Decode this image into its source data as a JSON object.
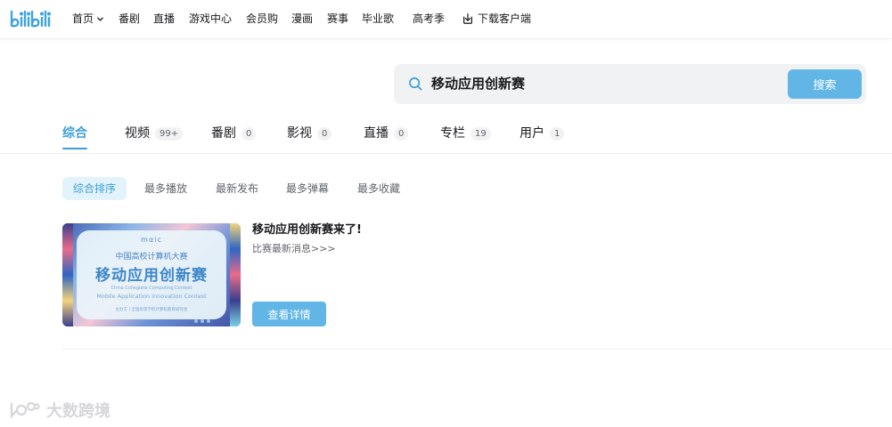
{
  "header": {
    "logo_text": "bilibili",
    "nav": [
      {
        "label": "首页"
      },
      {
        "label": "番剧"
      },
      {
        "label": "直播"
      },
      {
        "label": "游戏中心"
      },
      {
        "label": "会员购"
      },
      {
        "label": "漫画"
      },
      {
        "label": "赛事"
      },
      {
        "label": "毕业歌"
      },
      {
        "label": "高考季"
      },
      {
        "label": "下载客户端"
      }
    ]
  },
  "search": {
    "query": "移动应用创新赛",
    "button_label": "搜索"
  },
  "tabs": [
    {
      "label": "综合",
      "count": ""
    },
    {
      "label": "视频",
      "count": "99+"
    },
    {
      "label": "番剧",
      "count": "0"
    },
    {
      "label": "影视",
      "count": "0"
    },
    {
      "label": "直播",
      "count": "0"
    },
    {
      "label": "专栏",
      "count": "19"
    },
    {
      "label": "用户",
      "count": "1"
    }
  ],
  "sort_options": [
    {
      "label": "综合排序"
    },
    {
      "label": "最多播放"
    },
    {
      "label": "最新发布"
    },
    {
      "label": "最多弹幕"
    },
    {
      "label": "最多收藏"
    }
  ],
  "result": {
    "title": "移动应用创新赛来了!",
    "description": "比赛最新消息>>>",
    "button_label": "查看详情",
    "thumbnail": {
      "logo": "mαic",
      "line1": "中国高校计算机大赛",
      "line2": "移动应用创新赛",
      "line3": "China Collegiate Computing Contest",
      "line4": "Mobile Application Innovation Contest",
      "line5": "主办方 | 全国高等学校计算机教育研究会"
    }
  },
  "watermark": {
    "text": "大数跨境"
  },
  "colors": {
    "accent": "#3c9fd6",
    "button": "#62b6e6",
    "logo": "#3fa3dc"
  }
}
